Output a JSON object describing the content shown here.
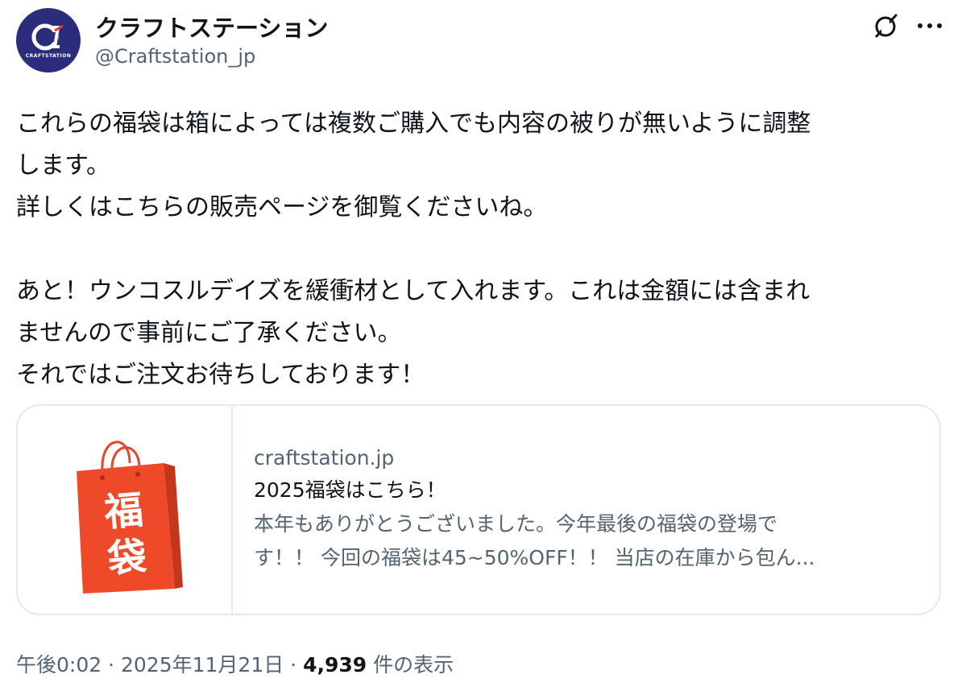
{
  "account": {
    "display_name": "クラフトステーション",
    "handle": "@Craftstation_jp",
    "avatar_logo_text": "CRAFTSTATION"
  },
  "tweet": {
    "paragraphs": [
      "これらの福袋は箱によっては複数ご購入でも内容の被りが無いように調整\nします。\n詳しくはこちらの販売ページを御覧くださいね。",
      "あと！ウンコスルデイズを緩衝材として入れます。これは金額には含まれ\nませんので事前にご了承ください。\nそれではご注文お待ちしております！"
    ]
  },
  "card": {
    "domain": "craftstation.jp",
    "title": "2025福袋はこちら！",
    "description_line1": "本年もありがとうございました。今年最後の福袋の登場で",
    "description_line2": "す！！ 今回の福袋は45~50%OFF！！ 当店の在庫から包ん...",
    "thumbnail_icon": "lucky-bag-icon",
    "thumbnail_text_1": "福",
    "thumbnail_text_2": "袋",
    "bag_color": "#ee4a2a"
  },
  "meta": {
    "time": "午後0:02",
    "separator": " · ",
    "date": "2025年11月21日",
    "views_count": "4,939",
    "views_label": " 件の表示"
  },
  "icons": {
    "grok": "grok-icon",
    "more": "more-icon"
  },
  "colors": {
    "text_primary": "#0f1419",
    "text_secondary": "#536471",
    "border": "#e4e9ed",
    "avatar_bg": "#2b2d7c"
  }
}
